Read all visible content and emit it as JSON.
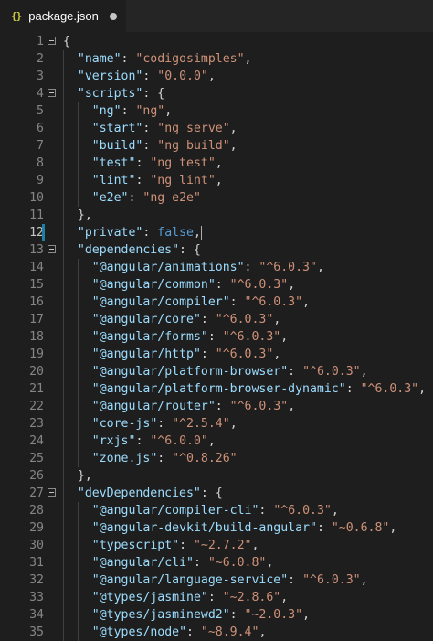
{
  "tab": {
    "icon": "{}",
    "filename": "package.json",
    "unsaved": true
  },
  "active_line": 12,
  "lines": [
    {
      "n": "1",
      "indent": 0,
      "fold": true,
      "toks": [
        [
          "p",
          "{"
        ]
      ]
    },
    {
      "n": "2",
      "indent": 1,
      "toks": [
        [
          "k",
          "\"name\""
        ],
        [
          "p",
          ": "
        ],
        [
          "s",
          "\"codigosimples\""
        ],
        [
          "p",
          ","
        ]
      ]
    },
    {
      "n": "3",
      "indent": 1,
      "toks": [
        [
          "k",
          "\"version\""
        ],
        [
          "p",
          ": "
        ],
        [
          "s",
          "\"0.0.0\""
        ],
        [
          "p",
          ","
        ]
      ]
    },
    {
      "n": "4",
      "indent": 1,
      "fold": true,
      "toks": [
        [
          "k",
          "\"scripts\""
        ],
        [
          "p",
          ": {"
        ]
      ]
    },
    {
      "n": "5",
      "indent": 2,
      "toks": [
        [
          "k",
          "\"ng\""
        ],
        [
          "p",
          ": "
        ],
        [
          "s",
          "\"ng\""
        ],
        [
          "p",
          ","
        ]
      ]
    },
    {
      "n": "6",
      "indent": 2,
      "toks": [
        [
          "k",
          "\"start\""
        ],
        [
          "p",
          ": "
        ],
        [
          "s",
          "\"ng serve\""
        ],
        [
          "p",
          ","
        ]
      ]
    },
    {
      "n": "7",
      "indent": 2,
      "toks": [
        [
          "k",
          "\"build\""
        ],
        [
          "p",
          ": "
        ],
        [
          "s",
          "\"ng build\""
        ],
        [
          "p",
          ","
        ]
      ]
    },
    {
      "n": "8",
      "indent": 2,
      "toks": [
        [
          "k",
          "\"test\""
        ],
        [
          "p",
          ": "
        ],
        [
          "s",
          "\"ng test\""
        ],
        [
          "p",
          ","
        ]
      ]
    },
    {
      "n": "9",
      "indent": 2,
      "toks": [
        [
          "k",
          "\"lint\""
        ],
        [
          "p",
          ": "
        ],
        [
          "s",
          "\"ng lint\""
        ],
        [
          "p",
          ","
        ]
      ]
    },
    {
      "n": "10",
      "indent": 2,
      "toks": [
        [
          "k",
          "\"e2e\""
        ],
        [
          "p",
          ": "
        ],
        [
          "s",
          "\"ng e2e\""
        ]
      ]
    },
    {
      "n": "11",
      "indent": 1,
      "toks": [
        [
          "p",
          "},"
        ]
      ]
    },
    {
      "n": "12",
      "indent": 1,
      "active": true,
      "toks": [
        [
          "k",
          "\"private\""
        ],
        [
          "p",
          ": "
        ],
        [
          "b",
          "false"
        ],
        [
          "p",
          ","
        ]
      ]
    },
    {
      "n": "13",
      "indent": 1,
      "fold": true,
      "toks": [
        [
          "k",
          "\"dependencies\""
        ],
        [
          "p",
          ": {"
        ]
      ]
    },
    {
      "n": "14",
      "indent": 2,
      "toks": [
        [
          "k",
          "\"@angular/animations\""
        ],
        [
          "p",
          ": "
        ],
        [
          "s",
          "\"^6.0.3\""
        ],
        [
          "p",
          ","
        ]
      ]
    },
    {
      "n": "15",
      "indent": 2,
      "toks": [
        [
          "k",
          "\"@angular/common\""
        ],
        [
          "p",
          ": "
        ],
        [
          "s",
          "\"^6.0.3\""
        ],
        [
          "p",
          ","
        ]
      ]
    },
    {
      "n": "16",
      "indent": 2,
      "toks": [
        [
          "k",
          "\"@angular/compiler\""
        ],
        [
          "p",
          ": "
        ],
        [
          "s",
          "\"^6.0.3\""
        ],
        [
          "p",
          ","
        ]
      ]
    },
    {
      "n": "17",
      "indent": 2,
      "toks": [
        [
          "k",
          "\"@angular/core\""
        ],
        [
          "p",
          ": "
        ],
        [
          "s",
          "\"^6.0.3\""
        ],
        [
          "p",
          ","
        ]
      ]
    },
    {
      "n": "18",
      "indent": 2,
      "toks": [
        [
          "k",
          "\"@angular/forms\""
        ],
        [
          "p",
          ": "
        ],
        [
          "s",
          "\"^6.0.3\""
        ],
        [
          "p",
          ","
        ]
      ]
    },
    {
      "n": "19",
      "indent": 2,
      "toks": [
        [
          "k",
          "\"@angular/http\""
        ],
        [
          "p",
          ": "
        ],
        [
          "s",
          "\"^6.0.3\""
        ],
        [
          "p",
          ","
        ]
      ]
    },
    {
      "n": "20",
      "indent": 2,
      "toks": [
        [
          "k",
          "\"@angular/platform-browser\""
        ],
        [
          "p",
          ": "
        ],
        [
          "s",
          "\"^6.0.3\""
        ],
        [
          "p",
          ","
        ]
      ]
    },
    {
      "n": "21",
      "indent": 2,
      "toks": [
        [
          "k",
          "\"@angular/platform-browser-dynamic\""
        ],
        [
          "p",
          ": "
        ],
        [
          "s",
          "\"^6.0.3\""
        ],
        [
          "p",
          ","
        ]
      ]
    },
    {
      "n": "22",
      "indent": 2,
      "toks": [
        [
          "k",
          "\"@angular/router\""
        ],
        [
          "p",
          ": "
        ],
        [
          "s",
          "\"^6.0.3\""
        ],
        [
          "p",
          ","
        ]
      ]
    },
    {
      "n": "23",
      "indent": 2,
      "toks": [
        [
          "k",
          "\"core-js\""
        ],
        [
          "p",
          ": "
        ],
        [
          "s",
          "\"^2.5.4\""
        ],
        [
          "p",
          ","
        ]
      ]
    },
    {
      "n": "24",
      "indent": 2,
      "toks": [
        [
          "k",
          "\"rxjs\""
        ],
        [
          "p",
          ": "
        ],
        [
          "s",
          "\"^6.0.0\""
        ],
        [
          "p",
          ","
        ]
      ]
    },
    {
      "n": "25",
      "indent": 2,
      "toks": [
        [
          "k",
          "\"zone.js\""
        ],
        [
          "p",
          ": "
        ],
        [
          "s",
          "\"^0.8.26\""
        ]
      ]
    },
    {
      "n": "26",
      "indent": 1,
      "toks": [
        [
          "p",
          "},"
        ]
      ]
    },
    {
      "n": "27",
      "indent": 1,
      "fold": true,
      "toks": [
        [
          "k",
          "\"devDependencies\""
        ],
        [
          "p",
          ": {"
        ]
      ]
    },
    {
      "n": "28",
      "indent": 2,
      "toks": [
        [
          "k",
          "\"@angular/compiler-cli\""
        ],
        [
          "p",
          ": "
        ],
        [
          "s",
          "\"^6.0.3\""
        ],
        [
          "p",
          ","
        ]
      ]
    },
    {
      "n": "29",
      "indent": 2,
      "toks": [
        [
          "k",
          "\"@angular-devkit/build-angular\""
        ],
        [
          "p",
          ": "
        ],
        [
          "s",
          "\"~0.6.8\""
        ],
        [
          "p",
          ","
        ]
      ]
    },
    {
      "n": "30",
      "indent": 2,
      "toks": [
        [
          "k",
          "\"typescript\""
        ],
        [
          "p",
          ": "
        ],
        [
          "s",
          "\"~2.7.2\""
        ],
        [
          "p",
          ","
        ]
      ]
    },
    {
      "n": "31",
      "indent": 2,
      "toks": [
        [
          "k",
          "\"@angular/cli\""
        ],
        [
          "p",
          ": "
        ],
        [
          "s",
          "\"~6.0.8\""
        ],
        [
          "p",
          ","
        ]
      ]
    },
    {
      "n": "32",
      "indent": 2,
      "toks": [
        [
          "k",
          "\"@angular/language-service\""
        ],
        [
          "p",
          ": "
        ],
        [
          "s",
          "\"^6.0.3\""
        ],
        [
          "p",
          ","
        ]
      ]
    },
    {
      "n": "33",
      "indent": 2,
      "toks": [
        [
          "k",
          "\"@types/jasmine\""
        ],
        [
          "p",
          ": "
        ],
        [
          "s",
          "\"~2.8.6\""
        ],
        [
          "p",
          ","
        ]
      ]
    },
    {
      "n": "34",
      "indent": 2,
      "toks": [
        [
          "k",
          "\"@types/jasminewd2\""
        ],
        [
          "p",
          ": "
        ],
        [
          "s",
          "\"~2.0.3\""
        ],
        [
          "p",
          ","
        ]
      ]
    },
    {
      "n": "35",
      "indent": 2,
      "toks": [
        [
          "k",
          "\"@types/node\""
        ],
        [
          "p",
          ": "
        ],
        [
          "s",
          "\"~8.9.4\""
        ],
        [
          "p",
          ","
        ]
      ]
    }
  ],
  "colors": {
    "background": "#1e1e1e",
    "key": "#9cdcfe",
    "string": "#ce9178",
    "boolean": "#569cd6",
    "punctuation": "#d4d4d4",
    "line_number": "#858585",
    "modified_marker": "#1b81a8"
  }
}
